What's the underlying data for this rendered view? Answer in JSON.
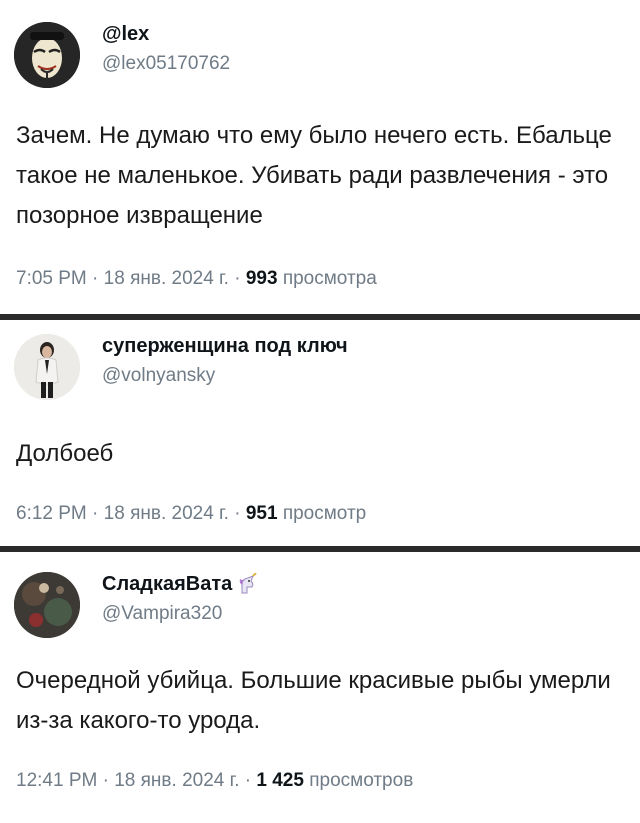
{
  "tweets": [
    {
      "display_name": "@lex",
      "handle": "@lex05170762",
      "text": "Зачем. Не думаю что ему было нечего есть. Ебальце такое не маленькое. Убивать ради развлечения - это позорное извращение",
      "time": "7:05 PM",
      "date": "18 янв. 2024 г.",
      "views": "993",
      "views_label": "просмотра",
      "sep": "·"
    },
    {
      "display_name": "суперженщина под ключ",
      "handle": "@volnyansky",
      "text": "Долбоеб",
      "time": "6:12 PM",
      "date": "18 янв. 2024 г.",
      "views": "951",
      "views_label": "просмотр",
      "sep": "·"
    },
    {
      "display_name": "СладкаяВата",
      "display_icon": "unicorn-emoji",
      "handle": "@Vampira320",
      "text": "Очередной убийца. Большие красивые рыбы умерли из-за какого-то урода.",
      "time": "12:41 PM",
      "date": "18 янв. 2024 г.",
      "views": "1 425",
      "views_label": "просмотров",
      "sep": "·"
    }
  ]
}
